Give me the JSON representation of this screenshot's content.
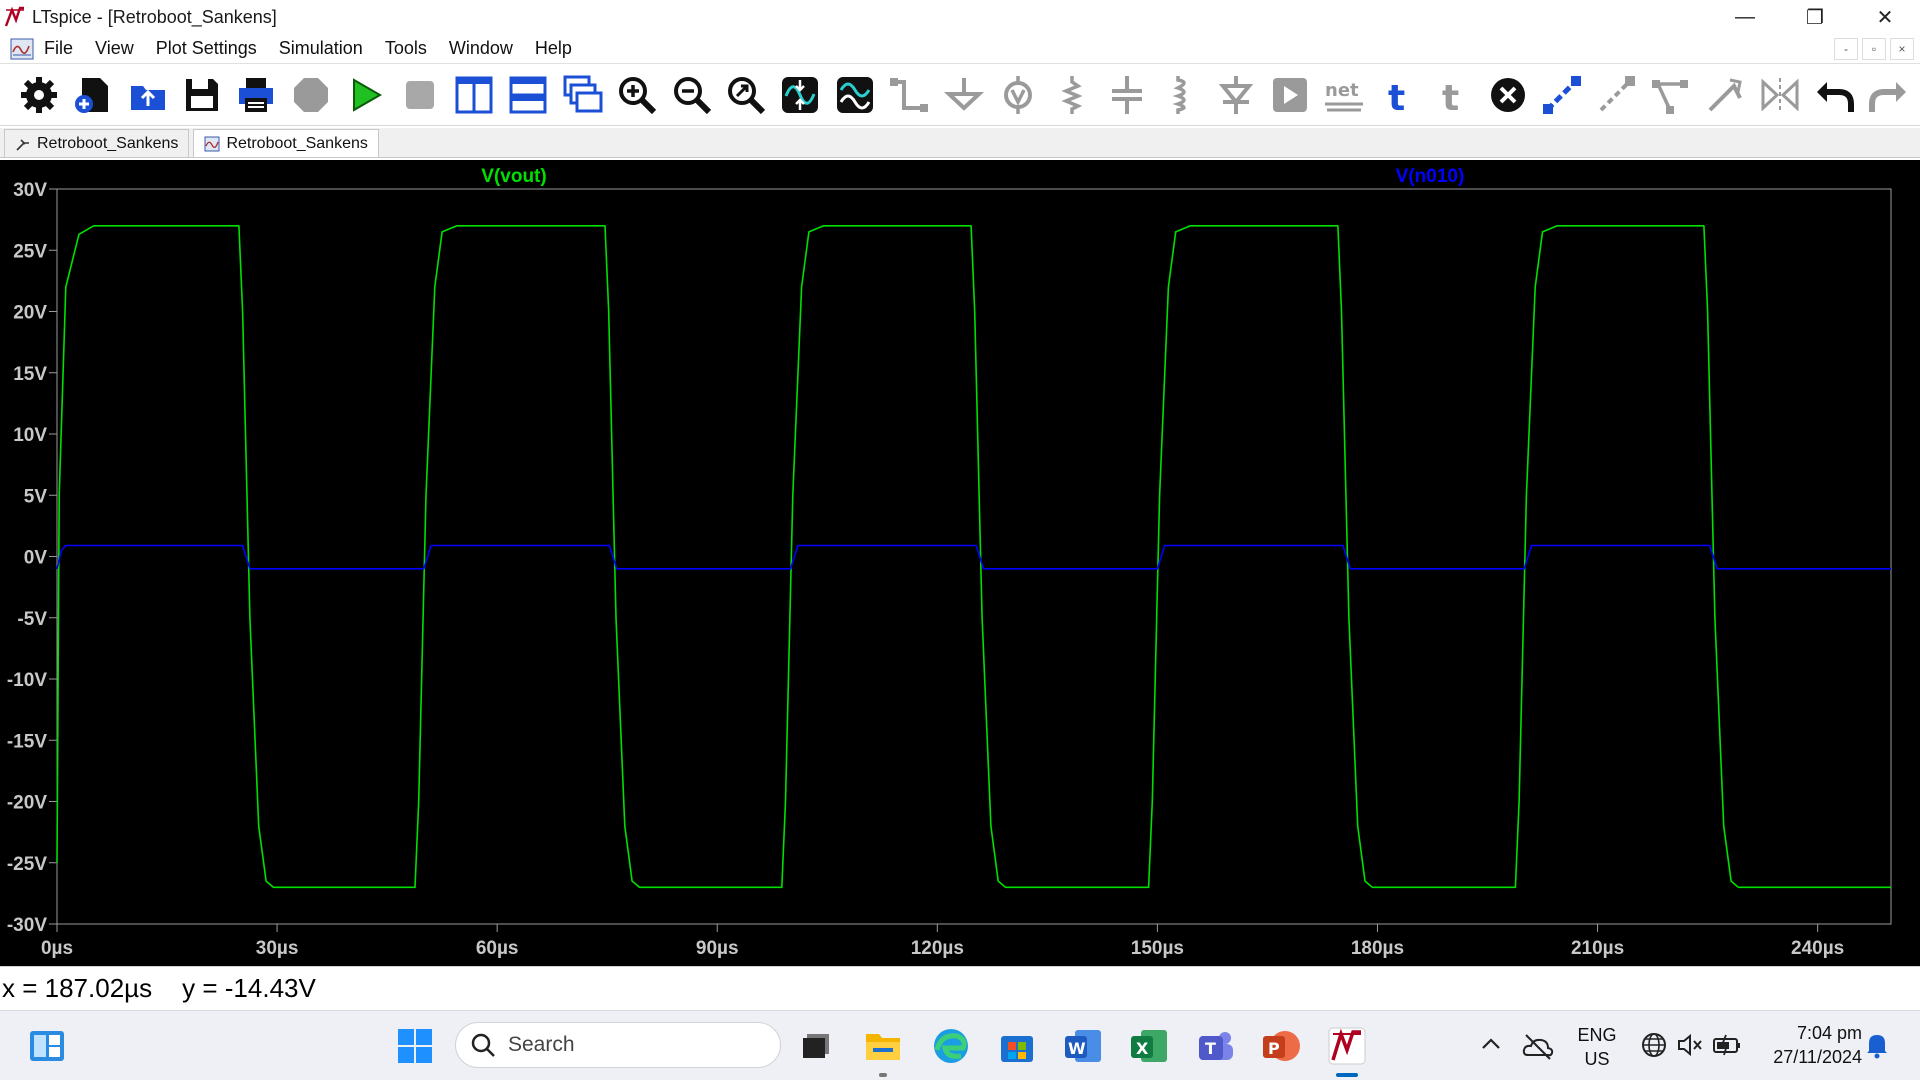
{
  "window": {
    "title": "LTspice - [Retroboot_Sankens]",
    "controls": [
      "—",
      "❐",
      "✕"
    ]
  },
  "menu": {
    "items": [
      "File",
      "View",
      "Plot Settings",
      "Simulation",
      "Tools",
      "Window",
      "Help"
    ],
    "mdi_controls": [
      "-",
      "▫",
      "×"
    ]
  },
  "toolbar": {
    "icons": [
      "gear-icon",
      "new-schematic-icon",
      "open-icon",
      "save-icon",
      "print-icon",
      "settings-disabled-icon",
      "run-icon",
      "halt-icon",
      "tile-vertical-icon",
      "tile-horizontal-icon",
      "cascade-icon",
      "zoom-in-icon",
      "zoom-out-icon",
      "zoom-fit-icon",
      "autorange-icon",
      "waveform-icon",
      "wire-icon",
      "ground-icon",
      "voltage-source-icon",
      "resistor-icon",
      "capacitor-icon",
      "inductor-icon",
      "diode-icon",
      "component-icon",
      "net-label-icon",
      "text-icon",
      "spice-directive-icon",
      "delete-icon",
      "duplicate-icon",
      "move-icon",
      "drag-icon",
      "rotate-icon",
      "mirror-icon",
      "undo-icon",
      "redo-icon"
    ]
  },
  "tabs": [
    {
      "label": "Retroboot_Sankens",
      "icon": "schematic-icon",
      "active": false
    },
    {
      "label": "Retroboot_Sankens",
      "icon": "waveform-tab-icon",
      "active": true
    }
  ],
  "colors": {
    "trace_vout": "#00e000",
    "trace_n010": "#0000ff",
    "plot_bg": "#000000",
    "axis": "#9a9a9a",
    "tick_label": "#c8c8c8"
  },
  "chart_data": {
    "type": "line",
    "title": "",
    "xlabel": "",
    "ylabel": "",
    "x_unit": "µs",
    "y_unit": "V",
    "xlim": [
      0,
      250
    ],
    "ylim": [
      -30,
      30
    ],
    "grid": false,
    "x_ticks": [
      0,
      30,
      60,
      90,
      120,
      150,
      180,
      210,
      240
    ],
    "x_tick_labels": [
      "0µs",
      "30µs",
      "60µs",
      "90µs",
      "120µs",
      "150µs",
      "180µs",
      "210µs",
      "240µs"
    ],
    "y_ticks": [
      30,
      25,
      20,
      15,
      10,
      5,
      0,
      -5,
      -10,
      -15,
      -20,
      -25,
      -30
    ],
    "y_tick_labels": [
      "30V",
      "25V",
      "20V",
      "15V",
      "10V",
      "5V",
      "0V",
      "-5V",
      "-10V",
      "-15V",
      "-20V",
      "-25V",
      "-30V"
    ],
    "series": [
      {
        "name": "V(vout)",
        "color": "#00e000",
        "x": [
          0,
          0.3,
          1.2,
          3,
          5,
          24.8,
          25.3,
          26.3,
          27.5,
          28.5,
          29.5,
          48.8,
          49.3,
          50.3,
          51.5,
          52.5,
          54.5,
          74.7,
          75.2,
          76.2,
          77.4,
          78.4,
          79.4,
          98.8,
          99.3,
          100.3,
          101.5,
          102.5,
          104.5,
          124.6,
          125.1,
          126.1,
          127.3,
          128.3,
          129.3,
          148.8,
          149.3,
          150.3,
          151.5,
          152.5,
          154.5,
          174.6,
          175.1,
          176.1,
          177.3,
          178.3,
          179.3,
          198.8,
          199.3,
          200.3,
          201.5,
          202.5,
          204.5,
          224.5,
          225.0,
          226.0,
          227.2,
          228.2,
          229.2,
          250
        ],
        "y": [
          -25,
          5,
          22,
          26.3,
          27,
          27,
          20,
          -5,
          -22,
          -26.5,
          -27,
          -27,
          -20,
          5,
          22,
          26.5,
          27,
          27,
          20,
          -5,
          -22,
          -26.5,
          -27,
          -27,
          -20,
          5,
          22,
          26.5,
          27,
          27,
          20,
          -5,
          -22,
          -26.5,
          -27,
          -27,
          -20,
          5,
          22,
          26.5,
          27,
          27,
          20,
          -5,
          -22,
          -26.5,
          -27,
          -27,
          -20,
          5,
          22,
          26.5,
          27,
          27,
          20,
          -5,
          -22,
          -26.5,
          -27,
          -27
        ]
      },
      {
        "name": "V(n010)",
        "color": "#0000ff",
        "x": [
          0,
          0.6,
          1.2,
          25.3,
          26.3,
          50.0,
          51.0,
          75.3,
          76.3,
          100.0,
          101.0,
          125.3,
          126.3,
          150.0,
          151.0,
          175.3,
          176.3,
          200.0,
          201.0,
          225.3,
          226.3,
          250
        ],
        "y": [
          -1,
          0.5,
          0.9,
          0.9,
          -1,
          -1,
          0.9,
          0.9,
          -1,
          -1,
          0.9,
          0.9,
          -1,
          -1,
          0.9,
          0.9,
          -1,
          -1,
          0.9,
          0.9,
          -1,
          -1
        ]
      }
    ]
  },
  "status": {
    "x_readout": "x = 187.02µs",
    "y_readout": "y = -14.43V"
  },
  "taskbar": {
    "search_label": "Search",
    "apps": [
      "task-view-icon",
      "file-explorer-icon",
      "edge-icon",
      "store-icon",
      "word-icon",
      "excel-icon",
      "teams-icon",
      "powerpoint-icon",
      "ltspice-icon"
    ],
    "lang_line1": "ENG",
    "lang_line2": "US",
    "time": "7:04 pm",
    "date": "27/11/2024"
  }
}
